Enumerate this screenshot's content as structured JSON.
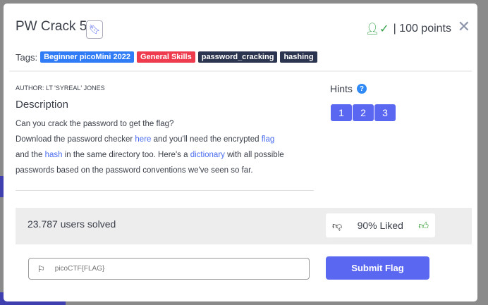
{
  "title": "PW Crack 5",
  "points": "| 100 points",
  "tags_label": "Tags:",
  "tags": [
    {
      "label": "Beginner picoMini 2022",
      "color": "#2f7cf6"
    },
    {
      "label": "General Skills",
      "color": "#ee3b4e"
    },
    {
      "label": "password_cracking",
      "color": "#2c3550"
    },
    {
      "label": "hashing",
      "color": "#2c3550"
    }
  ],
  "author": "AUTHOR: LT 'SYREAL' JONES",
  "description_heading": "Description",
  "description": {
    "l1": "Can you crack the password to get the flag?",
    "l2a": "Download the password checker ",
    "here": "here",
    "l2b": " and you'll need the encrypted ",
    "flag": "flag",
    "l3a": "and the ",
    "hash": "hash",
    "l3b": " in the same directory too. Here's a ",
    "dictionary": "dictionary",
    "l3c": " with all possible",
    "l4": "passwords based on the password conventions we've seen so far."
  },
  "hints": {
    "label": "Hints",
    "q": "?",
    "buttons": [
      "1",
      "2",
      "3"
    ]
  },
  "solved": "23.787 users solved",
  "liked": "90% Liked",
  "flag_placeholder": "picoCTF{FLAG}",
  "submit": "Submit Flag"
}
